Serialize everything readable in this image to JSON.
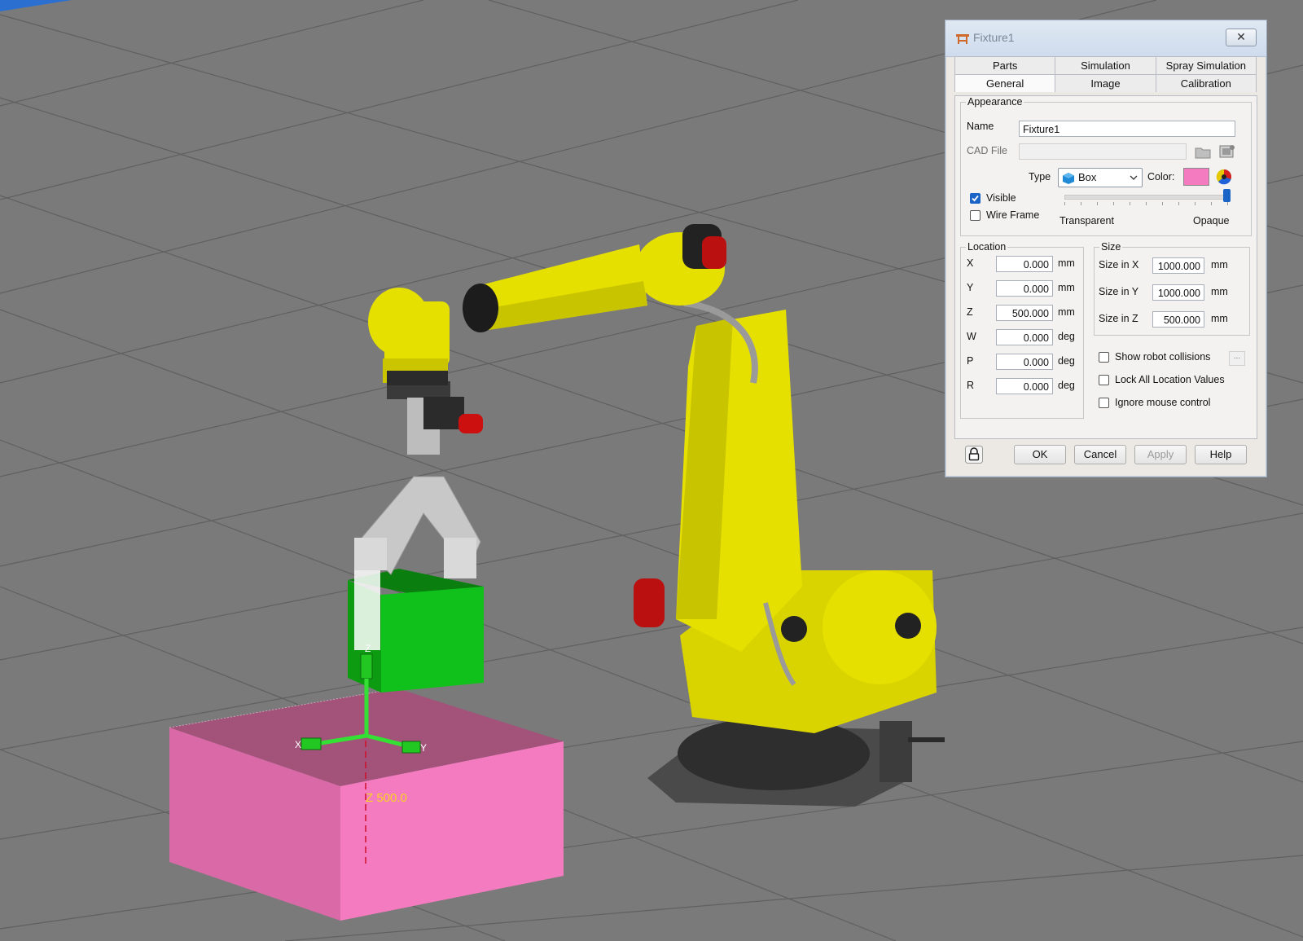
{
  "viewport": {
    "annotation_z": "Z 500.0",
    "axis_x": "X",
    "axis_y": "Y",
    "axis_z": "Z",
    "fixture_color": "#f47bbf",
    "part_color": "#11c11b",
    "robot_color": "#e6e000"
  },
  "dialog": {
    "title": "Fixture1",
    "close_label": "✕",
    "tabs_row1": [
      "Parts",
      "Simulation",
      "Spray Simulation"
    ],
    "tabs_row2": [
      "General",
      "Image",
      "Calibration"
    ],
    "active_tab": "General",
    "appearance": {
      "legend": "Appearance",
      "name_label": "Name",
      "name_value": "Fixture1",
      "cad_label": "CAD File",
      "cad_value": "",
      "type_label": "Type",
      "type_value": "Box",
      "color_label": "Color:",
      "color_value": "#f47bbf",
      "visible_label": "Visible",
      "visible_checked": true,
      "wireframe_label": "Wire Frame",
      "wireframe_checked": false,
      "transparent_label": "Transparent",
      "opaque_label": "Opaque",
      "opacity": 1.0
    },
    "location": {
      "legend": "Location",
      "rows": [
        {
          "label": "X",
          "value": "0.000",
          "unit": "mm"
        },
        {
          "label": "Y",
          "value": "0.000",
          "unit": "mm"
        },
        {
          "label": "Z",
          "value": "500.000",
          "unit": "mm"
        },
        {
          "label": "W",
          "value": "0.000",
          "unit": "deg"
        },
        {
          "label": "P",
          "value": "0.000",
          "unit": "deg"
        },
        {
          "label": "R",
          "value": "0.000",
          "unit": "deg"
        }
      ]
    },
    "size": {
      "legend": "Size",
      "rows": [
        {
          "label": "Size in X",
          "value": "1000.000",
          "unit": "mm"
        },
        {
          "label": "Size in Y",
          "value": "1000.000",
          "unit": "mm"
        },
        {
          "label": "Size in Z",
          "value": "500.000",
          "unit": "mm"
        }
      ]
    },
    "options": {
      "show_collisions": "Show robot collisions",
      "lock_location": "Lock All Location Values",
      "ignore_mouse": "Ignore mouse control",
      "more_label": "..."
    },
    "buttons": {
      "ok": "OK",
      "cancel": "Cancel",
      "apply": "Apply",
      "help": "Help"
    }
  }
}
